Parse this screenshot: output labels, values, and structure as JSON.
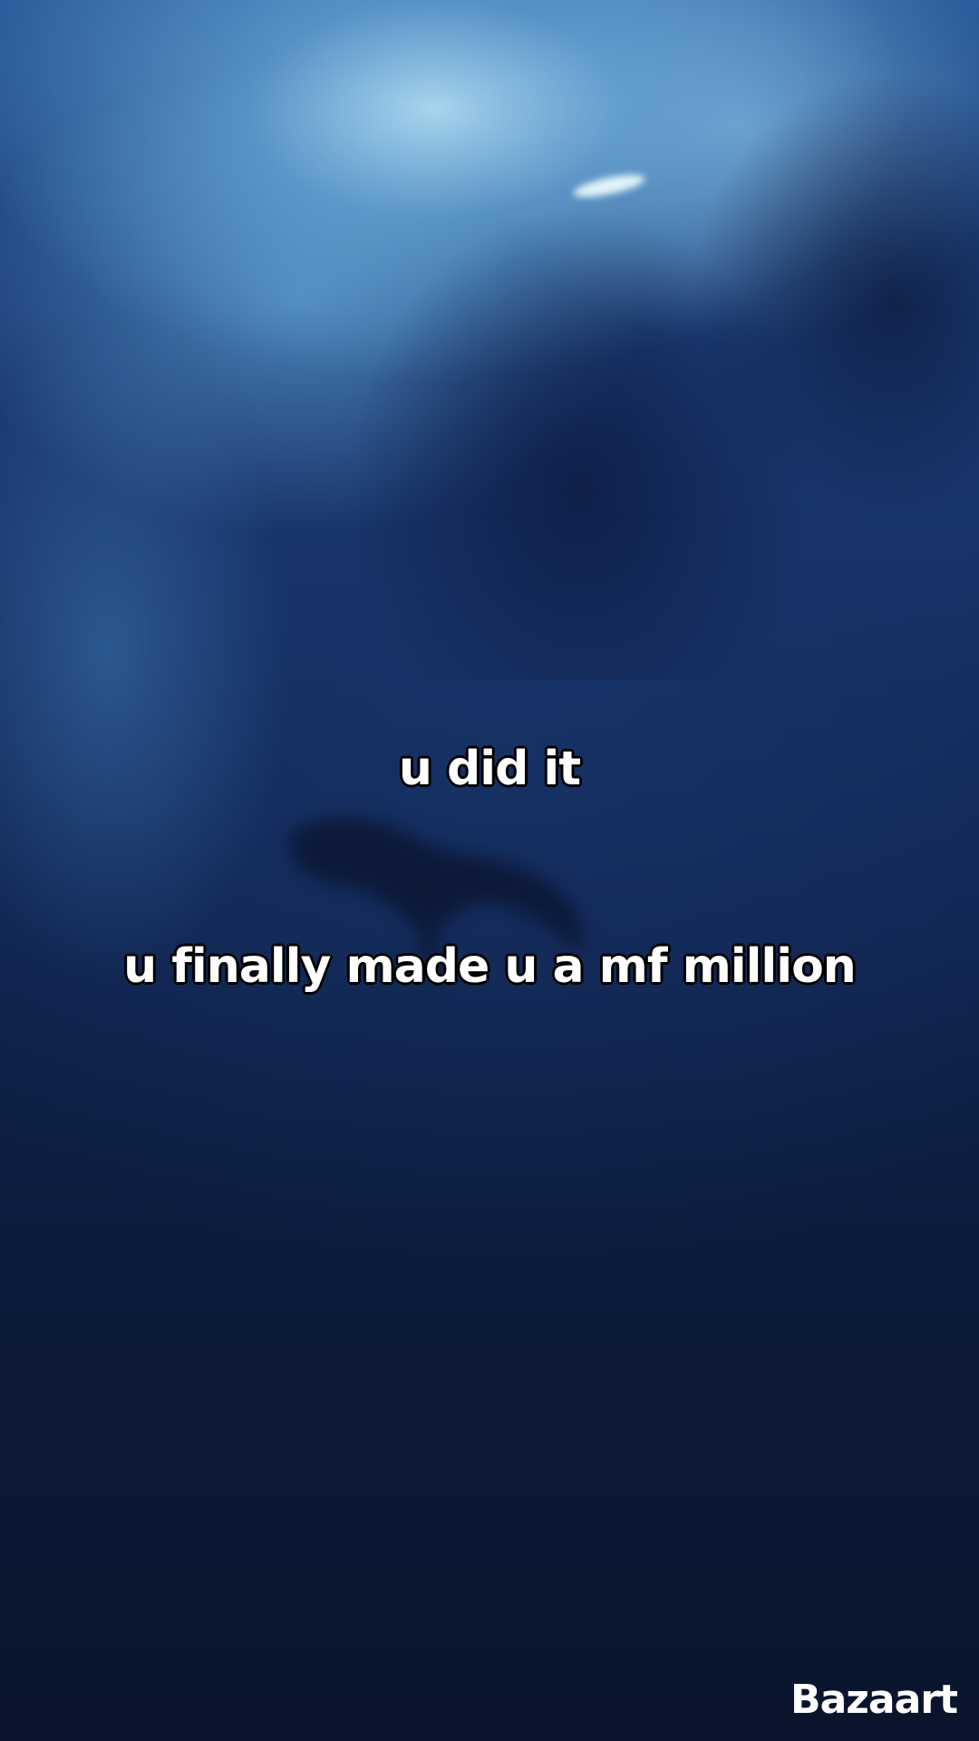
{
  "captions": {
    "line1": "u did it",
    "line2": "u finally made u a mf million"
  },
  "watermark": {
    "text": "Bazaart"
  },
  "background": {
    "description_colors": {
      "light": "#bfeaff",
      "mid": "#1c3d78",
      "deep": "#0a142c"
    }
  }
}
